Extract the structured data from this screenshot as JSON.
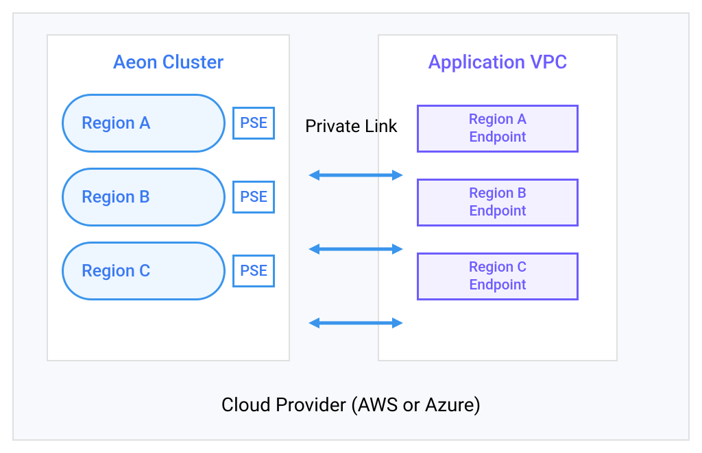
{
  "cluster": {
    "title": "Aeon Cluster",
    "rows": [
      {
        "region": "Region A",
        "pse": "PSE"
      },
      {
        "region": "Region B",
        "pse": "PSE"
      },
      {
        "region": "Region C",
        "pse": "PSE"
      }
    ]
  },
  "vpc": {
    "title": "Application VPC",
    "endpoints": [
      "Region A\nEndpoint",
      "Region B\nEndpoint",
      "Region C\nEndpoint"
    ]
  },
  "link_label": "Private Link",
  "footer": "Cloud Provider (AWS or Azure)",
  "colors": {
    "cluster": "#3a7af2",
    "cluster_border": "#3a95ec",
    "cluster_fill": "#eef6ff",
    "vpc": "#6d5cff",
    "vpc_fill": "#f3f1ff",
    "outer_bg": "#f7f9fc",
    "outer_border": "#e0e0e0",
    "arrow": "#3a95ec"
  }
}
